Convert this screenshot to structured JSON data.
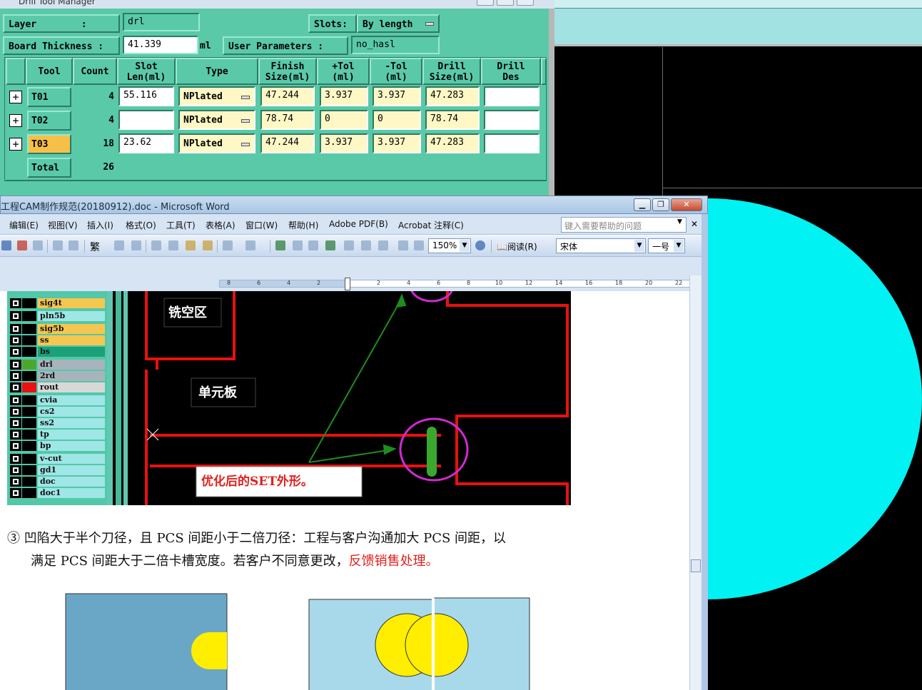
{
  "drill_tool_manager": {
    "title": "Drill Tool Manager",
    "layer_label": "Layer        :",
    "layer_value": "drl",
    "slots_label": "Slots:",
    "slots_value": "By length",
    "board_thickness_label": "Board Thickness :",
    "board_thickness_value": "41.339",
    "board_thickness_unit": "ml",
    "user_params_label": "User Parameters :",
    "user_params_value": "no_hasl",
    "columns": [
      {
        "l1": "Tool",
        "l2": ""
      },
      {
        "l1": "Count",
        "l2": ""
      },
      {
        "l1": "Slot",
        "l2": "Len(ml)"
      },
      {
        "l1": "Type",
        "l2": ""
      },
      {
        "l1": "Finish",
        "l2": "Size(ml)"
      },
      {
        "l1": "+Tol",
        "l2": "(ml)"
      },
      {
        "l1": "-Tol",
        "l2": "(ml)"
      },
      {
        "l1": "Drill",
        "l2": "Size(ml)"
      },
      {
        "l1": "Drill",
        "l2": "Des"
      }
    ],
    "rows": [
      {
        "tool": "T01",
        "count": "4",
        "slot_len": "55.116",
        "type": "NPlated",
        "finish": "47.244",
        "plus_tol": "3.937",
        "minus_tol": "3.937",
        "drill_size": "47.283",
        "drill_des": ""
      },
      {
        "tool": "T02",
        "count": "4",
        "slot_len": "",
        "type": "NPlated",
        "finish": "78.74",
        "plus_tol": "0",
        "minus_tol": "0",
        "drill_size": "78.74",
        "drill_des": ""
      },
      {
        "tool": "T03",
        "count": "18",
        "slot_len": "23.62",
        "type": "NPlated",
        "finish": "47.244",
        "plus_tol": "3.937",
        "minus_tol": "3.937",
        "drill_size": "47.283",
        "drill_des": ""
      }
    ],
    "total_label": "Total",
    "total_count": "26",
    "selected_tool": "T03",
    "colors": {
      "panel": "#5ac9a8",
      "input_yellow": "#fff8c6",
      "selected": "#f6c048"
    }
  },
  "word": {
    "title": "工程CAM制作规范(20180912).doc - Microsoft Word",
    "menu": [
      "编辑(E)",
      "视图(V)",
      "插入(I)",
      "格式(O)",
      "工具(T)",
      "表格(A)",
      "窗口(W)",
      "帮助(H)",
      "Adobe PDF(B)",
      "Acrobat 注释(C)"
    ],
    "help_placeholder": "键入需要帮助的问题",
    "zoom": "150%",
    "read_button": "阅读(R)",
    "font_name": "宋体",
    "font_size": "一号",
    "traditional_btn": "繁",
    "ruler_labels": [
      "8",
      "6",
      "4",
      "2",
      "2",
      "4",
      "6",
      "8",
      "10",
      "12",
      "14",
      "16",
      "18",
      "20",
      "22"
    ],
    "doc_image": {
      "layers": [
        {
          "name": "sig4t",
          "color": "#f5c650",
          "swatch": "#000000"
        },
        {
          "name": "pln5b",
          "color": "#9fe6e6",
          "swatch": "#000000"
        },
        {
          "name": "sig5b",
          "color": "#f5c650",
          "swatch": "#000000"
        },
        {
          "name": "ss",
          "color": "#f5c650",
          "swatch": "#000000"
        },
        {
          "name": "bs",
          "color": "#1ba078",
          "swatch": "#000000"
        },
        {
          "name": "drl",
          "color": "#a8b4bc",
          "swatch": "#4aa82e"
        },
        {
          "name": "2rd",
          "color": "#a8b4bc",
          "swatch": "#000000"
        },
        {
          "name": "rout",
          "color": "#d8d8d8",
          "swatch": "#e81010"
        },
        {
          "name": "cvia",
          "color": "#9fe6e6",
          "swatch": "#000000"
        },
        {
          "name": "cs2",
          "color": "#9fe6e6",
          "swatch": "#000000"
        },
        {
          "name": "ss2",
          "color": "#9fe6e6",
          "swatch": "#000000"
        },
        {
          "name": "tp",
          "color": "#9fe6e6",
          "swatch": "#000000"
        },
        {
          "name": "bp",
          "color": "#9fe6e6",
          "swatch": "#000000"
        },
        {
          "name": "v-cut",
          "color": "#9fe6e6",
          "swatch": "#000000"
        },
        {
          "name": "gd1",
          "color": "#9fe6e6",
          "swatch": "#000000"
        },
        {
          "name": "doc",
          "color": "#9fe6e6",
          "swatch": "#000000"
        },
        {
          "name": "doc1",
          "color": "#9fe6e6",
          "swatch": "#000000"
        }
      ],
      "label_mill_area": "铣空区",
      "label_unit_board": "单元板",
      "label_optimized": "优化后的SET外形。"
    },
    "paragraph_line1": "③ 凹陷大于半个刀径，且 PCS 间距小于二倍刀径：工程与客户沟通加大 PCS 间距，以",
    "paragraph_line2": "满足 PCS 间距大于二倍卡槽宽度。若客户不同意更改，",
    "paragraph_line2_red": "反馈销售处理。"
  }
}
